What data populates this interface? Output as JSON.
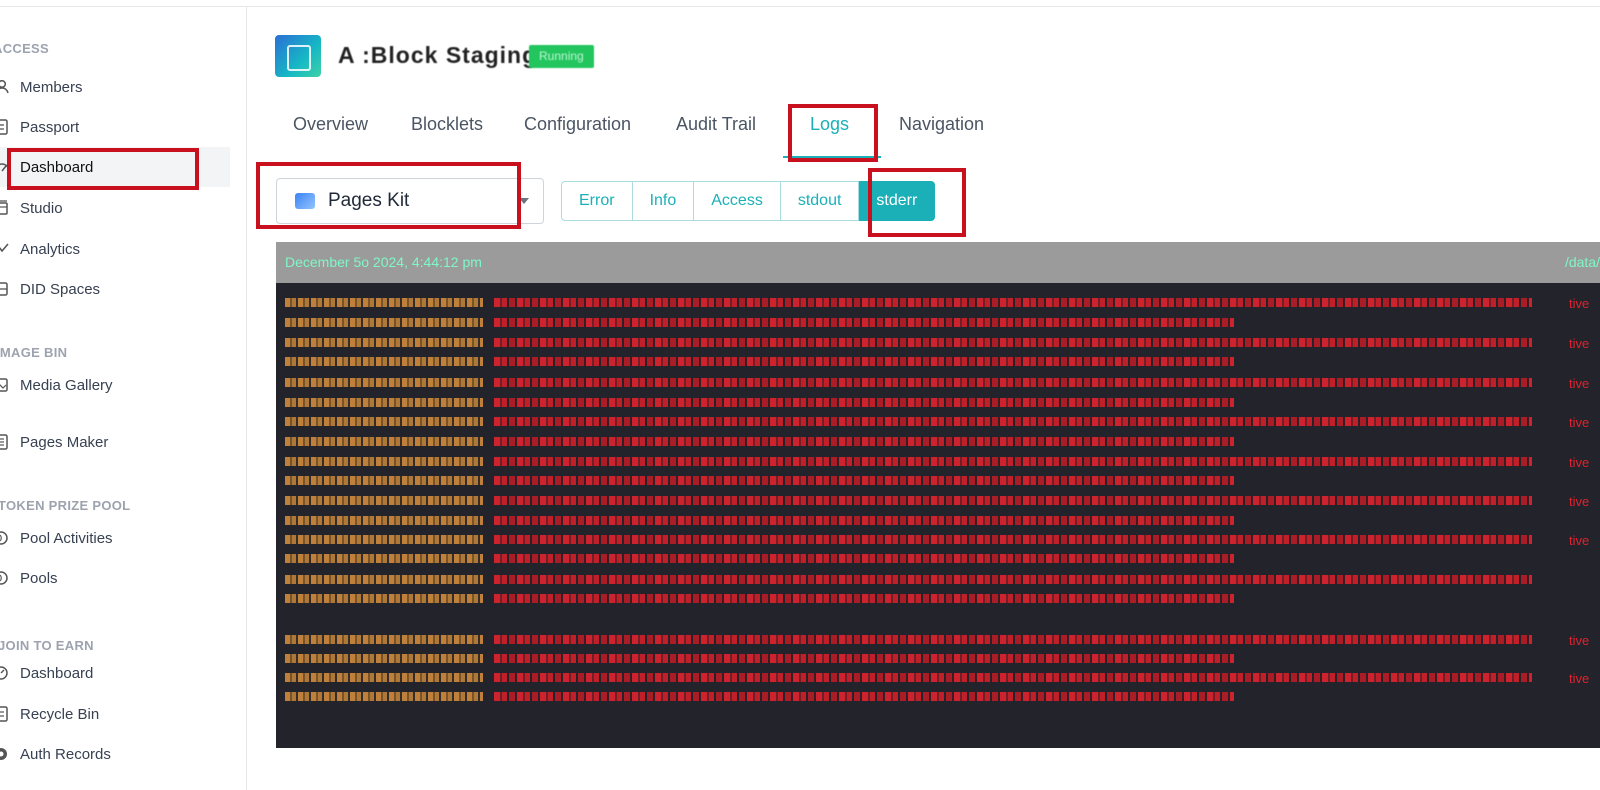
{
  "sidebar": {
    "sections": [
      {
        "title": "ACCESS"
      },
      {
        "title": "IMAGE BIN"
      },
      {
        "title": "TOKEN PRIZE POOL"
      },
      {
        "title": "JOIN TO EARN"
      }
    ],
    "items": [
      {
        "label": "Members",
        "icon": "user-icon"
      },
      {
        "label": "Passport",
        "icon": "passport-icon"
      },
      {
        "label": "Dashboard",
        "icon": "gauge-icon",
        "active": true
      },
      {
        "label": "Studio",
        "icon": "studio-icon"
      },
      {
        "label": "Analytics",
        "icon": "analytics-icon"
      },
      {
        "label": "DID Spaces",
        "icon": "storage-icon"
      },
      {
        "label": "Media Gallery",
        "icon": "image-icon"
      },
      {
        "label": "Pages Maker",
        "icon": "page-icon"
      },
      {
        "label": "Pool Activities",
        "icon": "pool-icon"
      },
      {
        "label": "Pools",
        "icon": "pool-icon"
      },
      {
        "label": "Dashboard",
        "icon": "gauge-icon"
      },
      {
        "label": "Recycle Bin",
        "icon": "recycle-icon"
      },
      {
        "label": "Auth Records",
        "icon": "record-icon"
      }
    ]
  },
  "header": {
    "app_title": "A :Block Staging",
    "badge": "Running"
  },
  "tabs": [
    {
      "label": "Overview"
    },
    {
      "label": "Blocklets"
    },
    {
      "label": "Configuration"
    },
    {
      "label": "Audit Trail"
    },
    {
      "label": "Logs",
      "active": true
    },
    {
      "label": "Navigation"
    }
  ],
  "select": {
    "value": "Pages Kit"
  },
  "log_types": [
    "Error",
    "Info",
    "Access",
    "stdout",
    "stderr"
  ],
  "selected_log_type": "stderr",
  "log": {
    "date": "December 5o 2024, 4:44:12 pm",
    "path": "/data/",
    "tail": "tive"
  },
  "colors": {
    "accent": "#1bb0b8",
    "highlight": "#c8101f",
    "log_bg": "#22232b",
    "log_header_bg": "#9b9b9b",
    "log_error": "#e0232e",
    "log_timestamp": "#d9903e"
  }
}
